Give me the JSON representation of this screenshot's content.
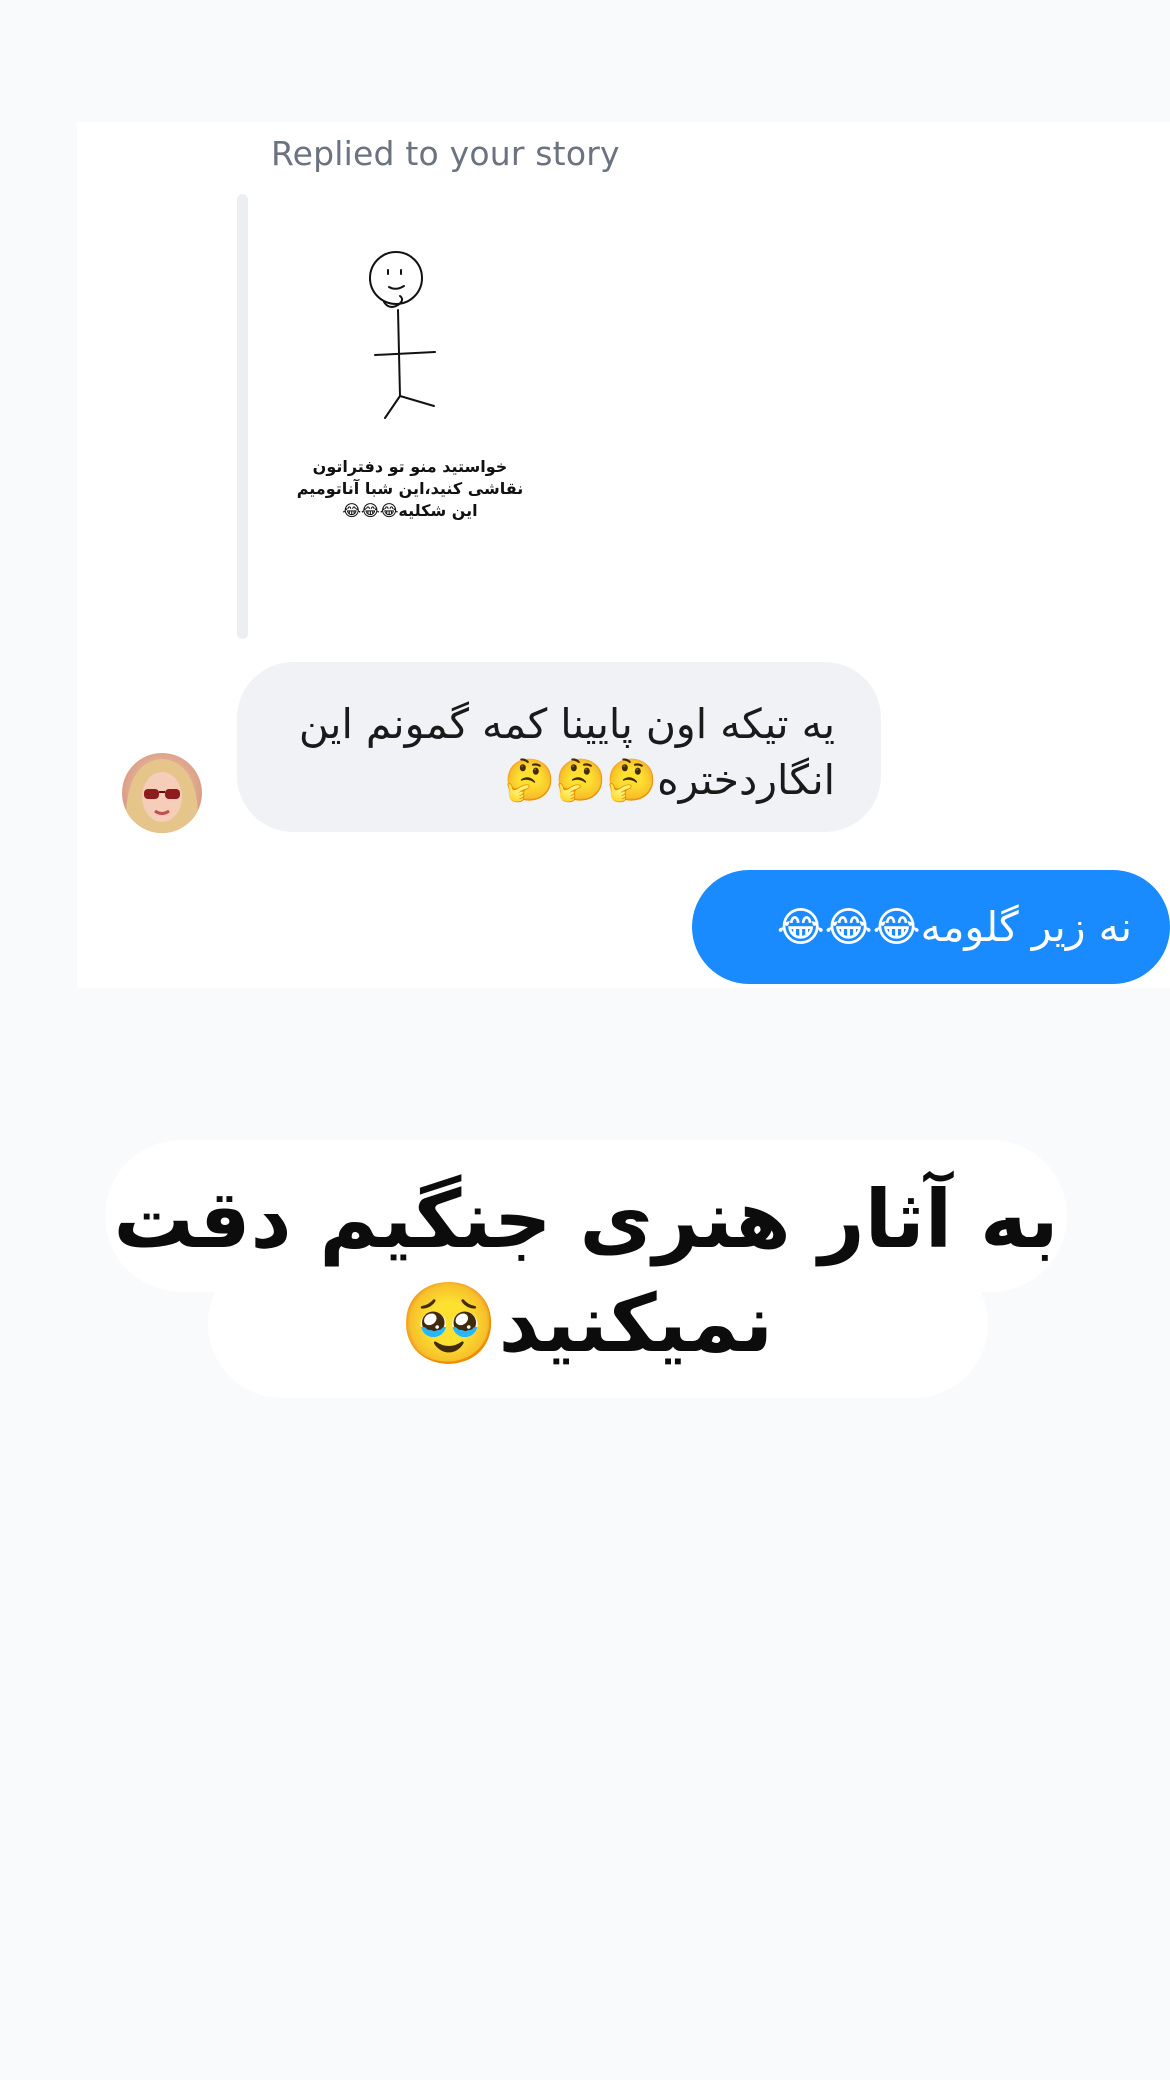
{
  "conversation": {
    "reply_label": "Replied to your story",
    "story": {
      "caption": "خواستید منو تو دفتراتون نقاشی کنید،این شبا آناتومیم این شکلیه😂😂😂"
    },
    "messages": [
      {
        "direction": "incoming",
        "text": "یه تیکه اون پایینا کمه گمونم این انگاردختره🤔🤔🤔"
      },
      {
        "direction": "outgoing",
        "text": "نه زیر گلومه😂😂😂"
      }
    ],
    "colors": {
      "incoming_bubble": "#f1f2f5",
      "outgoing_bubble": "#1a8bff",
      "reply_label": "#6b7280"
    }
  },
  "overlay": {
    "text": "به آثار هنری جنگیم دقت نمیکنید🥹"
  }
}
